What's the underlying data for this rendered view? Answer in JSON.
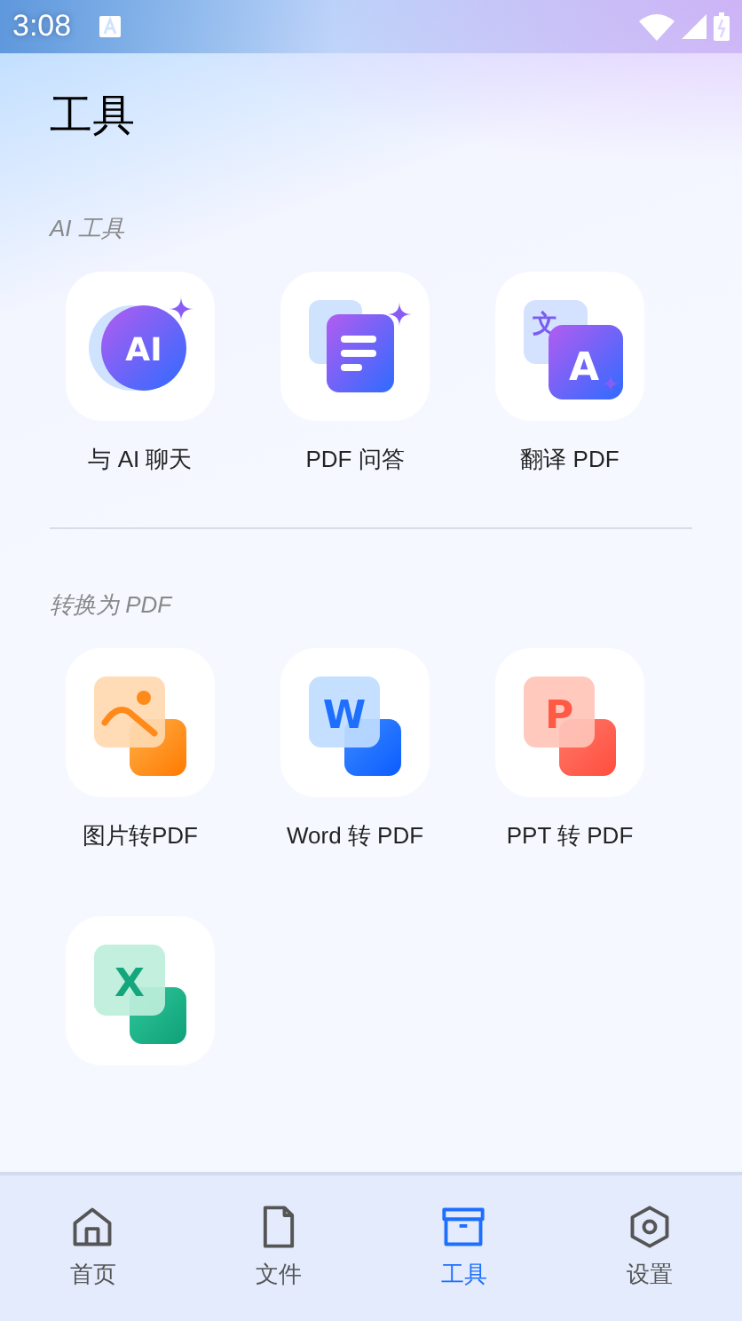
{
  "status_bar": {
    "time": "3:08"
  },
  "title": "工具",
  "sections": [
    {
      "heading": "AI 工具",
      "tools": [
        {
          "kind": "chat",
          "label": "与 AI 聊天",
          "glyphs": [
            "AI"
          ]
        },
        {
          "kind": "qa",
          "label": "PDF 问答"
        },
        {
          "kind": "translate",
          "label": "翻译 PDF",
          "glyphs": [
            "文",
            "A"
          ]
        }
      ]
    },
    {
      "heading": "转换为 PDF",
      "tools": [
        {
          "kind": "image",
          "label": "图片转PDF"
        },
        {
          "kind": "word",
          "label": "Word 转 PDF",
          "glyphs": [
            "W"
          ]
        },
        {
          "kind": "ppt",
          "label": "PPT 转 PDF",
          "glyphs": [
            "P"
          ]
        },
        {
          "kind": "excel",
          "glyphs": [
            "X"
          ]
        }
      ]
    }
  ],
  "nav": [
    {
      "kind": "home",
      "label": "首页",
      "selected": false
    },
    {
      "kind": "file",
      "label": "文件",
      "selected": false
    },
    {
      "kind": "tools",
      "label": "工具",
      "selected": true
    },
    {
      "kind": "settings",
      "label": "设置",
      "selected": false
    }
  ]
}
